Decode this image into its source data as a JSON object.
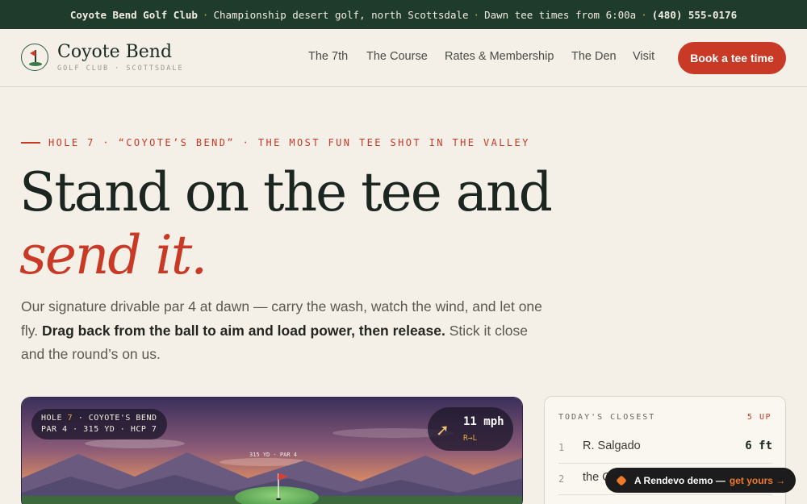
{
  "topbar": {
    "club": "Coyote Bend Golf Club",
    "tagline": "Championship desert golf, north Scottsdale",
    "hours": "Dawn tee times from 6:00a",
    "phone": "(480) 555-0176",
    "separator": "·"
  },
  "header": {
    "brand_name": "Coyote Bend",
    "brand_sub": "GOLF CLUB · SCOTTSDALE",
    "nav": [
      "The 7th",
      "The Course",
      "Rates & Membership",
      "The Den",
      "Visit"
    ],
    "cta": "Book a tee time"
  },
  "hero": {
    "eyebrow": "HOLE 7 · “COYOTE’S BEND” · THE MOST FUN TEE SHOT IN THE VALLEY",
    "headline_1": "Stand on the tee and",
    "headline_2": "send it.",
    "lede_1": "Our signature drivable par 4 at dawn — carry the wash, watch the wind, and let one fly.",
    "lede_bold": "Drag back from the ball to aim and load power, then release.",
    "lede_2": "Stick it close and the round’s on us."
  },
  "game": {
    "hole_label": "HOLE",
    "hole_number": "7",
    "hole_name": "· COYOTE'S BEND",
    "hole_details": "PAR 4 · 315 YD · HCP 7",
    "wind_speed": "11 mph",
    "wind_direction": "R→L",
    "pin_label": "315 YD · PAR 4"
  },
  "leaderboard": {
    "title": "TODAY'S CLOSEST",
    "count": "5 UP",
    "rows": [
      {
        "rank": "1",
        "name": "R. Salgado",
        "distance": "6 ft"
      },
      {
        "rank": "2",
        "name": "the C",
        "distance": ""
      }
    ]
  },
  "demo_badge": {
    "text": "A Rendevo demo —",
    "link": "get yours →"
  },
  "colors": {
    "accent": "#c83a26",
    "forest": "#1f3b2c",
    "cream": "#f4f0e8"
  }
}
